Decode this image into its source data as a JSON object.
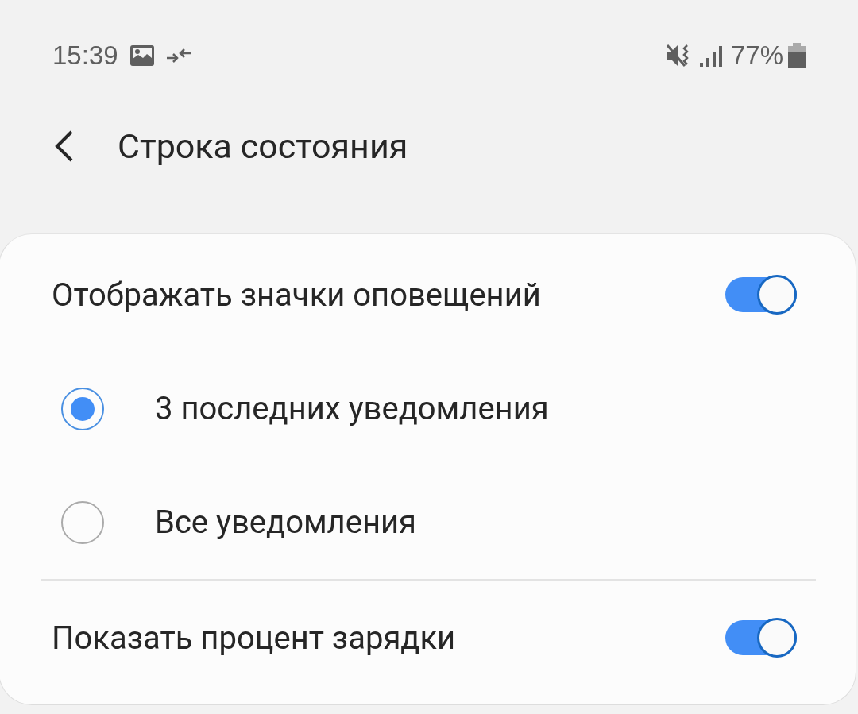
{
  "status_bar": {
    "time": "15:39",
    "battery": "77%"
  },
  "header": {
    "title": "Строка состояния"
  },
  "items": [
    {
      "kind": "toggle",
      "label": "Отображать значки оповещений",
      "on": true
    },
    {
      "kind": "radio",
      "label": "3 последних уведомления",
      "selected": true
    },
    {
      "kind": "radio",
      "label": "Все уведомления",
      "selected": false
    },
    {
      "kind": "toggle",
      "label": "Показать процент зарядки",
      "on": true
    }
  ]
}
